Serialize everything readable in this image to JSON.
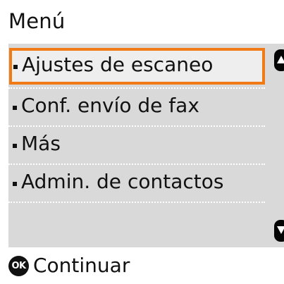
{
  "header": {
    "title": "Menú"
  },
  "menu": {
    "items": [
      {
        "label": "Ajustes de escaneo",
        "selected": true
      },
      {
        "label": "Conf. envío de fax",
        "selected": false
      },
      {
        "label": "Más",
        "selected": false
      },
      {
        "label": "Admin. de contactos",
        "selected": false
      }
    ]
  },
  "scroll": {
    "up_icon": "triangle-up-icon",
    "down_icon": "triangle-down-icon"
  },
  "footer": {
    "ok_icon_label": "OK",
    "action_label": "Continuar"
  },
  "colors": {
    "selection_border": "#f07b16",
    "menu_background": "#d9d9d9",
    "selected_background": "#eeeeee",
    "scroll_button": "#050505"
  }
}
